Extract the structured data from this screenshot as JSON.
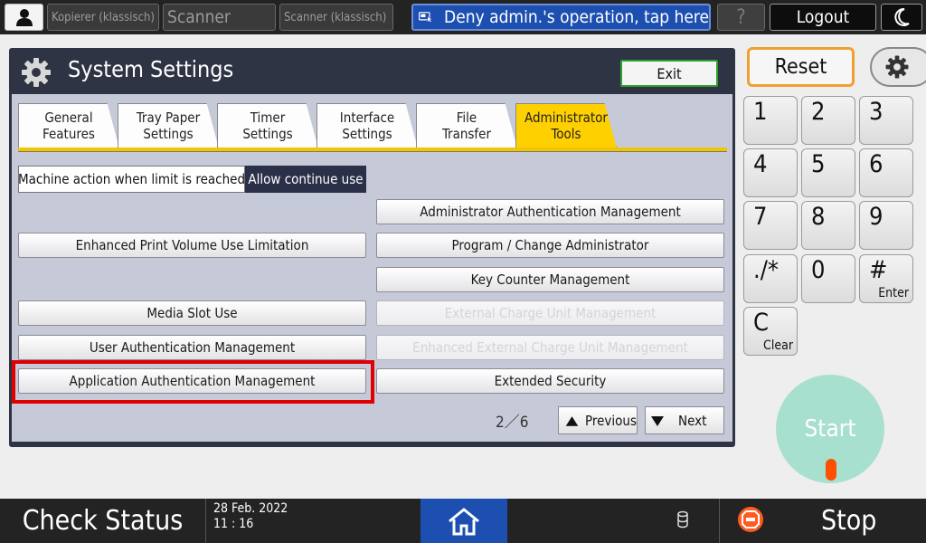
{
  "topbar": {
    "apps": [
      "Kopierer (klassisch)",
      "Scanner",
      "Scanner (klassisch)"
    ],
    "deny_label": "Deny admin.'s operation, tap here",
    "help_label": "?",
    "logout_label": "Logout"
  },
  "panel": {
    "title": "System Settings",
    "exit_label": "Exit",
    "tabs": [
      {
        "label": "General\nFeatures"
      },
      {
        "label": "Tray Paper\nSettings"
      },
      {
        "label": "Timer\nSettings"
      },
      {
        "label": "Interface\nSettings"
      },
      {
        "label": "File\nTransfer"
      },
      {
        "label": "Administrator\nTools"
      }
    ],
    "limit_label": "Machine action when limit is reached",
    "limit_value": "Allow continue use",
    "buttons_left": [
      "Enhanced Print Volume Use Limitation",
      "Media Slot Use",
      "User Authentication Management",
      "Application Authentication Management"
    ],
    "buttons_right": [
      "Administrator Authentication Management",
      "Program / Change Administrator",
      "Key Counter Management",
      "External Charge Unit Management",
      "Enhanced External Charge Unit Management",
      "Extended Security"
    ],
    "page_indicator": "2／6",
    "prev_label": "Previous",
    "next_label": "Next"
  },
  "keypad": {
    "reset_label": "Reset",
    "keys": [
      "1",
      "2",
      "3",
      "4",
      "5",
      "6",
      "7",
      "8",
      "9",
      "./*",
      "0",
      "#"
    ],
    "enter_sub": "Enter",
    "clear_key": "C",
    "clear_sub": "Clear",
    "start_label": "Start"
  },
  "bottombar": {
    "check_status": "Check Status",
    "date": "28 Feb. 2022",
    "time": "11 : 16",
    "stop_label": "Stop"
  },
  "colors": {
    "accent_tab": "#ffd000",
    "highlight": "#e00000",
    "deny_blue": "#1d4fb0",
    "reset_border": "#f0a030",
    "start_green": "#a8e0cf"
  }
}
